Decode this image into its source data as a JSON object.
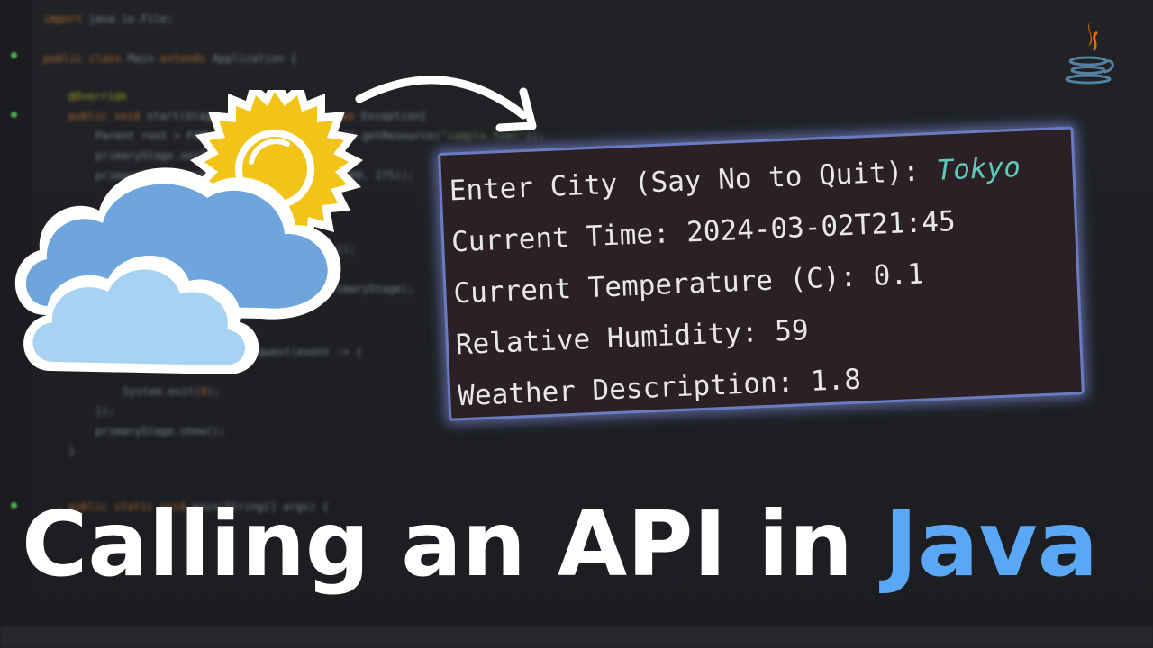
{
  "console": {
    "prompt_label": "Enter City (Say No to Quit): ",
    "prompt_value": "Tokyo",
    "lines": [
      "Current Time: 2024-03-02T21:45",
      "Current Temperature (C): 0.1",
      "Relative Humidity: 59",
      "Weather Description: 1.8"
    ]
  },
  "headline": {
    "prefix": "Calling an API in ",
    "accent_word": "Java"
  },
  "colors": {
    "accent": "#5aa8f5",
    "console_bg": "#2b2023",
    "console_border": "#6b7bbf",
    "input_value": "#5ec9b9",
    "cloud_dark": "#6ea5dc",
    "cloud_light": "#a8d2f2",
    "sun": "#f2c418"
  },
  "icons": {
    "weather": "partly-cloudy-icon",
    "arrow": "curved-arrow-icon",
    "logo": "java-logo-icon"
  }
}
